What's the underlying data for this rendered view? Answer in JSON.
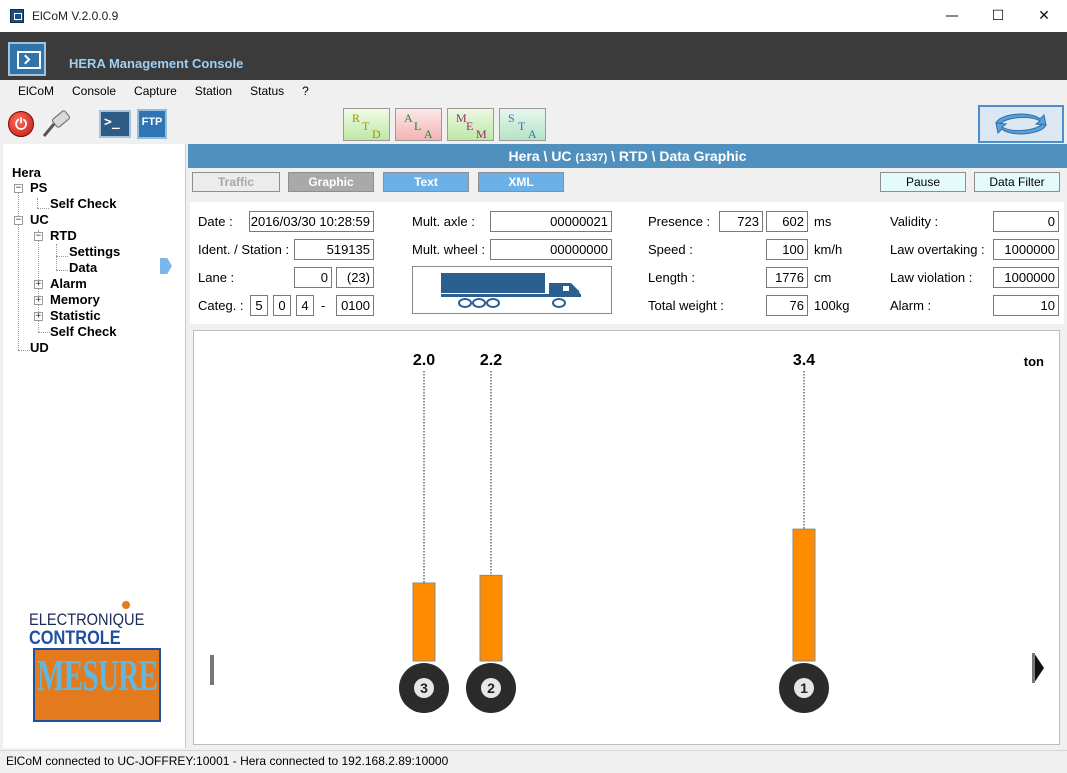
{
  "window": {
    "title": "ElCoM V.2.0.0.9",
    "minimize": "—",
    "maximize": "☐",
    "close": "✕"
  },
  "banner": {
    "title": "HERA Management Console"
  },
  "menu": [
    "ElCoM",
    "Console",
    "Capture",
    "Station",
    "Status",
    "?"
  ],
  "toolbar": {
    "ftp_label": "FTP",
    "console_label": ">_",
    "modes": [
      {
        "letters": [
          "R",
          "T",
          "D"
        ]
      },
      {
        "letters": [
          "A",
          "L",
          "A"
        ]
      },
      {
        "letters": [
          "M",
          "E",
          "M"
        ]
      },
      {
        "letters": [
          "S",
          "T",
          "A"
        ]
      }
    ]
  },
  "tree": {
    "root": "Hera",
    "ps": "PS",
    "ps_selfcheck": "Self Check",
    "uc": "UC",
    "rtd": "RTD",
    "settings": "Settings",
    "data": "Data",
    "alarm": "Alarm",
    "memory": "Memory",
    "statistic": "Statistic",
    "uc_selfcheck": "Self Check",
    "ud": "UD"
  },
  "logo": {
    "line1": "ELECTRONIQUE",
    "line2": "CONTROLE",
    "line3": "MESURE"
  },
  "main": {
    "path_a": "Hera \\ UC ",
    "path_id": "(1337)",
    "path_b": " \\ RTD \\ Data Graphic",
    "tabs": {
      "traffic": "Traffic",
      "graphic": "Graphic",
      "text": "Text",
      "xml": "XML",
      "pause": "Pause",
      "filter": "Data Filter"
    }
  },
  "record": {
    "date_label": "Date :",
    "date": "2016/03/30 10:28:59",
    "ident_label": "Ident. / Station :",
    "ident": "519135",
    "lane_label": "Lane :",
    "lane": "0",
    "lane_total": "(23)",
    "categ_label": "Categ. :",
    "categ": [
      "5",
      "0",
      "4"
    ],
    "categ_dash": "-",
    "categ_code": "0100",
    "mult_axle_label": "Mult. axle :",
    "mult_axle": "00000021",
    "mult_wheel_label": "Mult. wheel :",
    "mult_wheel": "00000000",
    "presence_label": "Presence :",
    "presence_a": "723",
    "presence_b": "602",
    "presence_unit": "ms",
    "speed_label": "Speed :",
    "speed": "100",
    "speed_unit": "km/h",
    "length_label": "Length :",
    "length": "1776",
    "length_unit": "cm",
    "weight_label": "Total weight :",
    "weight": "76",
    "weight_unit": "100kg",
    "validity_label": "Validity :",
    "validity": "0",
    "law_overtaking_label": "Law overtaking :",
    "law_overtaking": "1000000",
    "law_violation_label": "Law violation :",
    "law_violation": "1000000",
    "alarm_label": "Alarm :",
    "alarm": "10"
  },
  "graph": {
    "unit": "ton",
    "axles": [
      {
        "number": "3",
        "load": 2.0,
        "label": "2.0"
      },
      {
        "number": "2",
        "load": 2.2,
        "label": "2.2"
      },
      {
        "number": "1",
        "load": 3.4,
        "label": "3.4"
      }
    ],
    "bar_color": "#ff8c00"
  },
  "status": "ElCoM connected to UC-JOFFREY:10001  -  Hera connected to 192.168.2.89:10000"
}
